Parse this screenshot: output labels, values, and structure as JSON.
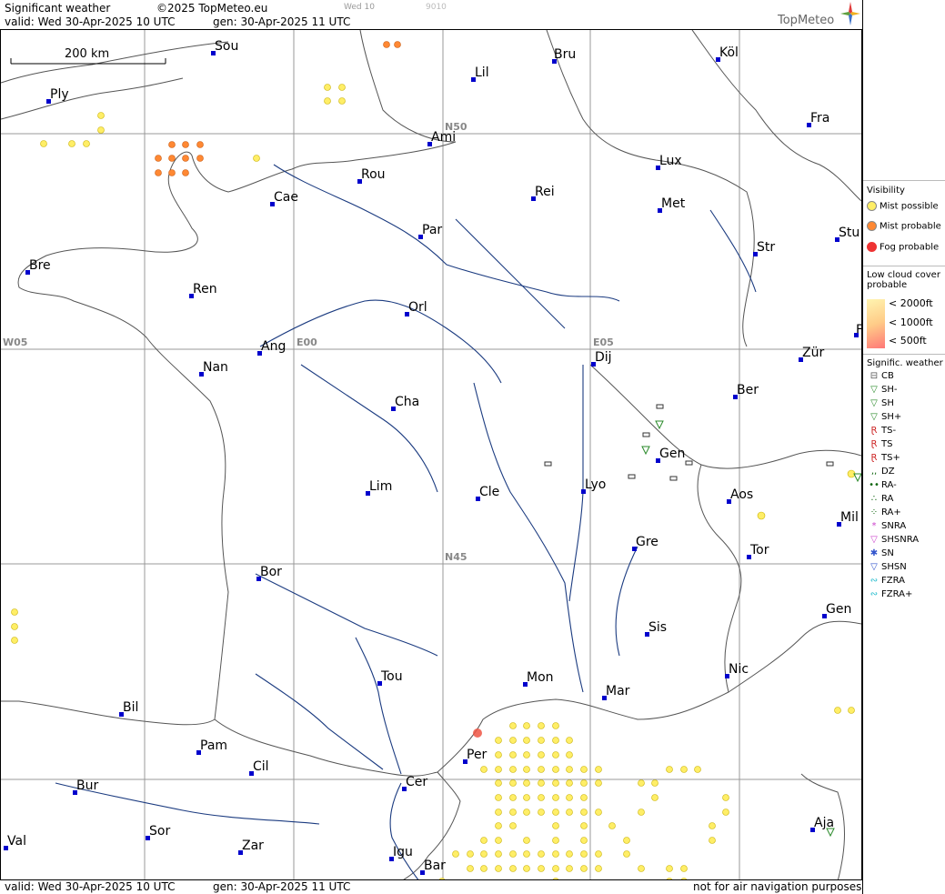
{
  "header": {
    "title": "Significant weather",
    "copyright": "©2025 TopMeteo.eu",
    "valid": "valid:  Wed   30-Apr-2025  10 UTC",
    "gen": "gen:  30-Apr-2025 11 UTC",
    "tab_label": "Wed 10",
    "code": "9010",
    "brand": "TopMeteo"
  },
  "map": {
    "scale_label": "200 km",
    "grid_labels": [
      "N50",
      "W05",
      "E00",
      "E05",
      "N45"
    ],
    "cities": [
      "Sou",
      "Bru",
      "Köl",
      "Lil",
      "Ply",
      "Ami",
      "Fra",
      "Lux",
      "Rou",
      "Cae",
      "Rei",
      "Met",
      "Par",
      "Bre",
      "Str",
      "Stu",
      "Ren",
      "Orl",
      "Ang",
      "Nan",
      "Dij",
      "Zür",
      "Ber",
      "Cha",
      "Gen",
      "Lim",
      "Cle",
      "Lyo",
      "Aos",
      "Mil",
      "Bor",
      "Gre",
      "Tor",
      "Sis",
      "Gen",
      "Tou",
      "Mon",
      "Nic",
      "Mar",
      "Bil",
      "Pam",
      "Cil",
      "Per",
      "Bur",
      "Cer",
      "Sor",
      "Zar",
      "Val",
      "Igu",
      "Aja",
      "Bar",
      "F"
    ]
  },
  "footer": {
    "valid": "valid:  Wed   30-Apr-2025  10 UTC",
    "gen": "gen:  30-Apr-2025 11 UTC",
    "disclaimer": "not for air navigation purposes"
  },
  "legend": {
    "visibility_title": "Visibility",
    "visibility": [
      {
        "label": "Mist possible",
        "color": "#ffee66"
      },
      {
        "label": "Mist probable",
        "color": "#ff8833"
      },
      {
        "label": "Fog probable",
        "color": "#ee3333"
      }
    ],
    "lowcloud_title": "Low cloud cover probable",
    "lowcloud": [
      {
        "label": "< 2000ft",
        "color": "#fff4b0"
      },
      {
        "label": "< 1000ft",
        "color": "#ffcc88"
      },
      {
        "label": "<  500ft",
        "color": "#ff7777"
      }
    ],
    "weather_title": "Signific. weather",
    "weather": [
      {
        "label": "CB",
        "color": "#555555"
      },
      {
        "label": "SH-",
        "color": "#2a8a2a"
      },
      {
        "label": "SH",
        "color": "#2a8a2a"
      },
      {
        "label": "SH+",
        "color": "#2a8a2a"
      },
      {
        "label": "TS-",
        "color": "#cc2222"
      },
      {
        "label": "TS",
        "color": "#cc2222"
      },
      {
        "label": "TS+",
        "color": "#cc2222"
      },
      {
        "label": "DZ",
        "color": "#116611"
      },
      {
        "label": "RA-",
        "color": "#116611"
      },
      {
        "label": "RA",
        "color": "#116611"
      },
      {
        "label": "RA+",
        "color": "#116611"
      },
      {
        "label": "SNRA",
        "color": "#cc44cc"
      },
      {
        "label": "SHSNRA",
        "color": "#cc44cc"
      },
      {
        "label": "SN",
        "color": "#3355cc"
      },
      {
        "label": "SHSN",
        "color": "#3355cc"
      },
      {
        "label": "FZRA",
        "color": "#22bbcc"
      },
      {
        "label": "FZRA+",
        "color": "#22bbcc"
      }
    ]
  }
}
